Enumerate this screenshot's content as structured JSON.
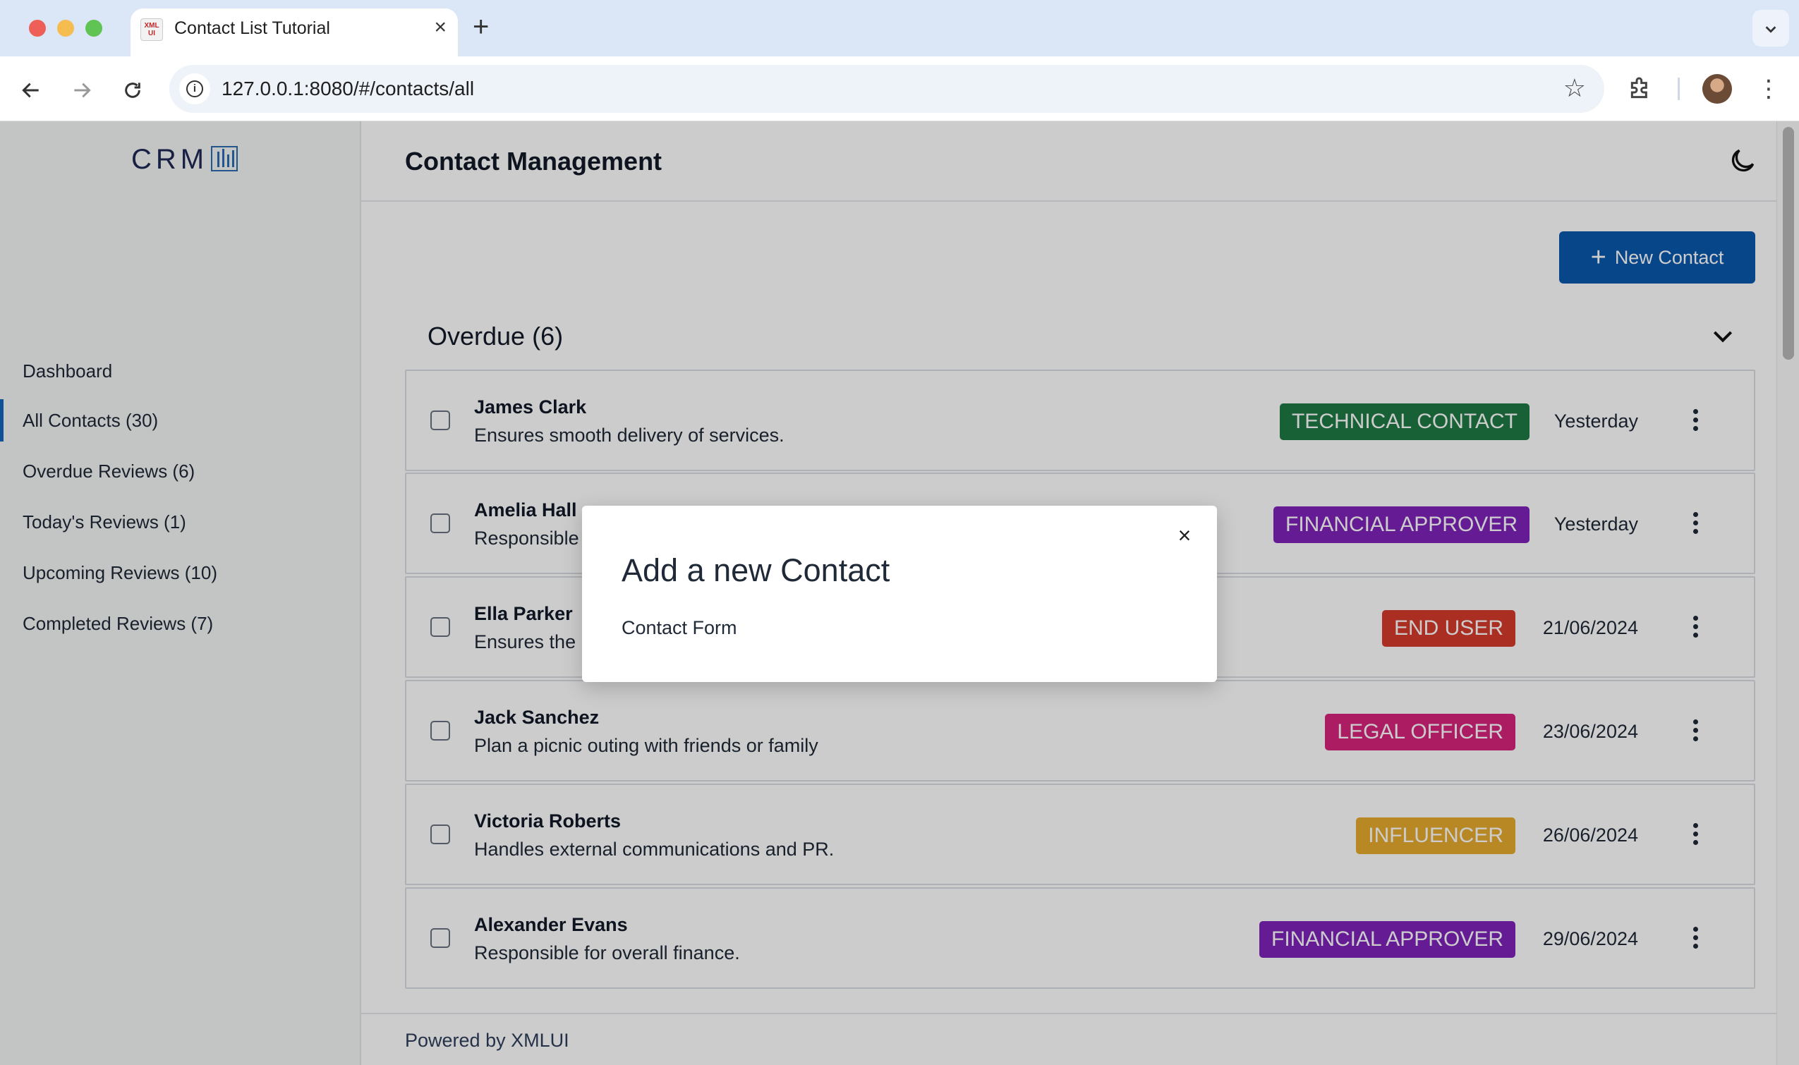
{
  "browser": {
    "tab_title": "Contact List Tutorial",
    "favicon_text": "XML UI",
    "tab_close": "×",
    "new_tab": "+",
    "tab_dropdown": "⌄",
    "url": "127.0.0.1:8080/#/contacts/all",
    "back": "←",
    "forward": "→",
    "reload": "↻",
    "info": "i",
    "star": "☆",
    "menu": "⋮"
  },
  "sidebar": {
    "logo_text": "CRM",
    "items": [
      {
        "label": "Dashboard",
        "active": false
      },
      {
        "label": "All Contacts (30)",
        "active": true
      },
      {
        "label": "Overdue Reviews (6)",
        "active": false
      },
      {
        "label": "Today's Reviews (1)",
        "active": false
      },
      {
        "label": "Upcoming Reviews (10)",
        "active": false
      },
      {
        "label": "Completed Reviews (7)",
        "active": false
      }
    ]
  },
  "header": {
    "title": "Contact Management"
  },
  "actions": {
    "new_contact_icon": "+",
    "new_contact_label": "New Contact"
  },
  "group": {
    "title": "Overdue (6)",
    "expanded": true
  },
  "contacts": [
    {
      "name": "James Clark",
      "description": "Ensures smooth delivery of services.",
      "badge": "TECHNICAL CONTACT",
      "badge_color": "#1e7a44",
      "date": "Yesterday"
    },
    {
      "name": "Amelia Hall",
      "description": "Responsible",
      "badge": "FINANCIAL APPROVER",
      "badge_color": "#7e22b8",
      "date": "Yesterday"
    },
    {
      "name": "Ella Parker",
      "description": "Ensures the p",
      "badge": "END USER",
      "badge_color": "#d63a2b",
      "date": "21/06/2024"
    },
    {
      "name": "Jack Sanchez",
      "description": "Plan a picnic outing with friends or family",
      "badge": "LEGAL OFFICER",
      "badge_color": "#d6247c",
      "date": "23/06/2024"
    },
    {
      "name": "Victoria Roberts",
      "description": "Handles external communications and PR.",
      "badge": "INFLUENCER",
      "badge_color": "#e7ab2e",
      "date": "26/06/2024"
    },
    {
      "name": "Alexander Evans",
      "description": "Responsible for overall finance.",
      "badge": "FINANCIAL APPROVER",
      "badge_color": "#7e22b8",
      "date": "29/06/2024"
    }
  ],
  "footer": {
    "text": "Powered by XMLUI"
  },
  "modal": {
    "title": "Add a new Contact",
    "body": "Contact Form",
    "close": "×"
  }
}
